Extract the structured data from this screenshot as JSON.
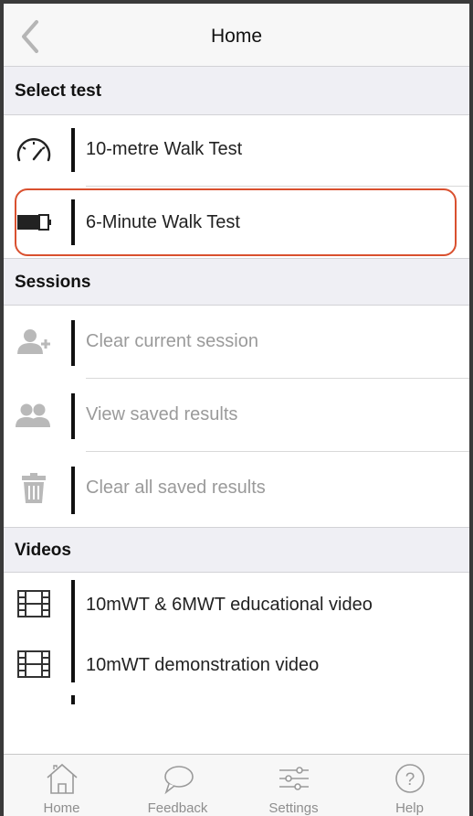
{
  "nav": {
    "title": "Home"
  },
  "sections": {
    "select_test": "Select test",
    "sessions": "Sessions",
    "videos": "Videos"
  },
  "select_test_items": [
    {
      "label": "10-metre Walk Test",
      "icon": "speedometer-icon"
    },
    {
      "label": "6-Minute Walk Test",
      "icon": "battery-icon",
      "highlighted": true
    }
  ],
  "session_items": [
    {
      "label": "Clear current session",
      "icon": "add-user-icon",
      "disabled": true
    },
    {
      "label": "View saved results",
      "icon": "users-icon",
      "disabled": true
    },
    {
      "label": "Clear all saved results",
      "icon": "trash-icon",
      "disabled": true
    }
  ],
  "video_items": [
    {
      "label": "10mWT & 6MWT educational video",
      "icon": "film-icon"
    },
    {
      "label": "10mWT demonstration video",
      "icon": "film-icon"
    }
  ],
  "tabbar": {
    "items": [
      {
        "label": "Home",
        "icon": "home-icon"
      },
      {
        "label": "Feedback",
        "icon": "speech-bubble-icon"
      },
      {
        "label": "Settings",
        "icon": "sliders-icon"
      },
      {
        "label": "Help",
        "icon": "question-icon"
      }
    ]
  },
  "colors": {
    "highlight": "#d9502f",
    "section_bg": "#efeff4",
    "disabled_text": "#9a9a9a",
    "tab_inactive": "#8e8e8e"
  }
}
